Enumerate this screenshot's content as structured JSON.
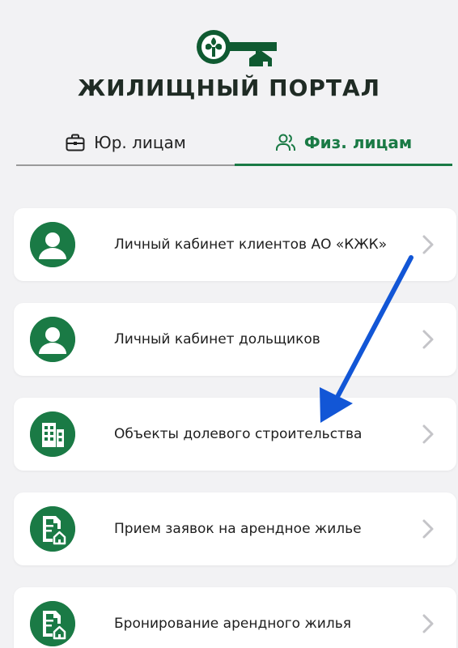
{
  "header": {
    "title": "ЖИЛИЩНЫЙ ПОРТАЛ"
  },
  "tabs": [
    {
      "label": "Юр. лицам",
      "icon": "briefcase-icon",
      "active": false
    },
    {
      "label": "Физ. лицам",
      "icon": "users-icon",
      "active": true
    }
  ],
  "menu": [
    {
      "label": "Личный кабинет клиентов АО «КЖК»",
      "icon": "user-avatar-icon"
    },
    {
      "label": "Личный кабинет дольщиков",
      "icon": "user-avatar-icon"
    },
    {
      "label": "Объекты долевого строительства",
      "icon": "buildings-icon"
    },
    {
      "label": "Прием заявок на арендное жилье",
      "icon": "document-house-icon"
    },
    {
      "label": "Бронирование арендного жилья",
      "icon": "document-house-icon"
    }
  ],
  "colors": {
    "brand_green": "#1a7a45",
    "background": "#f2f2f4",
    "annotation_arrow": "#1256d6"
  }
}
